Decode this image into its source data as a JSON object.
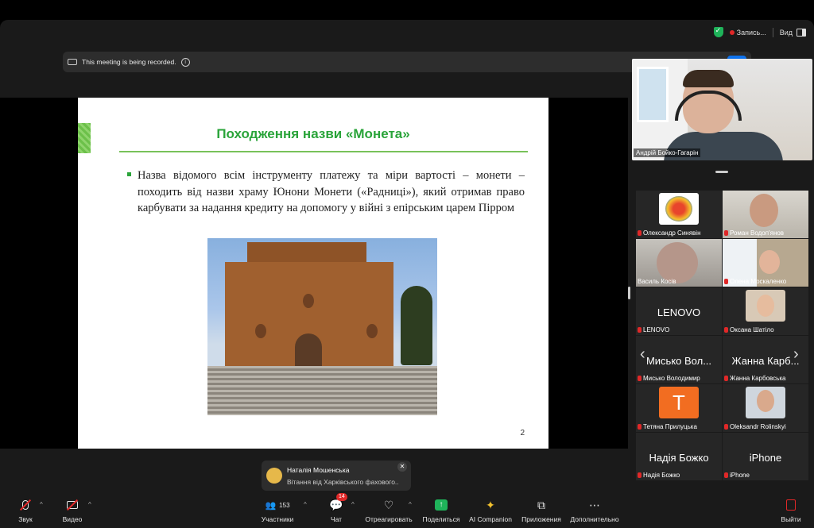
{
  "topbar": {
    "recording_label": "Запись...",
    "view_label": "Вид"
  },
  "banner": {
    "text": "This meeting is being recorded.",
    "ok_label": "OK"
  },
  "slide": {
    "title": "Походження назви «Монета»",
    "bullet": "Назва відомого всім інструменту платежу та міри вартості – монети – походить від назви храму Юнони Монети («Радниці»), який отримав право карбувати за надання кредиту на допомогу у війні з епірським царем Пірром",
    "page_number": "2"
  },
  "speaker": {
    "name": "Андрій Бойко-Гагарін"
  },
  "participants": [
    {
      "label": "Олександр Синявін",
      "big": ""
    },
    {
      "label": "Роман Водоп'янов",
      "big": ""
    },
    {
      "label": "Василь Косів",
      "big": ""
    },
    {
      "label": "Олена Москаленко",
      "big": ""
    },
    {
      "label": "LENOVO",
      "big": "LENOVO"
    },
    {
      "label": "Оксана Шатіло",
      "big": ""
    },
    {
      "label": "Мисько Володимир",
      "big": "Мисько Вол..."
    },
    {
      "label": "Жанна Карбовська",
      "big": "Жанна Карб..."
    },
    {
      "label": "Тетяна Прилуцька",
      "big": "T"
    },
    {
      "label": "Oleksandr Rolinskyi",
      "big": ""
    },
    {
      "label": "Надія Божко",
      "big": "Надія Божко"
    },
    {
      "label": "iPhone",
      "big": "iPhone"
    }
  ],
  "toast": {
    "sender": "Наталія Мошенська",
    "message": "Вітання від Харківського фахового..."
  },
  "toolbar": {
    "audio": "Звук",
    "video": "Видео",
    "participants": "Участники",
    "participants_count": "153",
    "chat": "Чат",
    "chat_badge": "14",
    "react": "Отреагировать",
    "share": "Поделиться",
    "ai": "AI Companion",
    "apps": "Приложения",
    "more": "Дополнительно",
    "leave": "Выйти"
  },
  "colors": {
    "accent": "#0e72ed",
    "slide_green": "#2aa43a",
    "share_green": "#1fb35a",
    "mute_red": "#e02828"
  }
}
